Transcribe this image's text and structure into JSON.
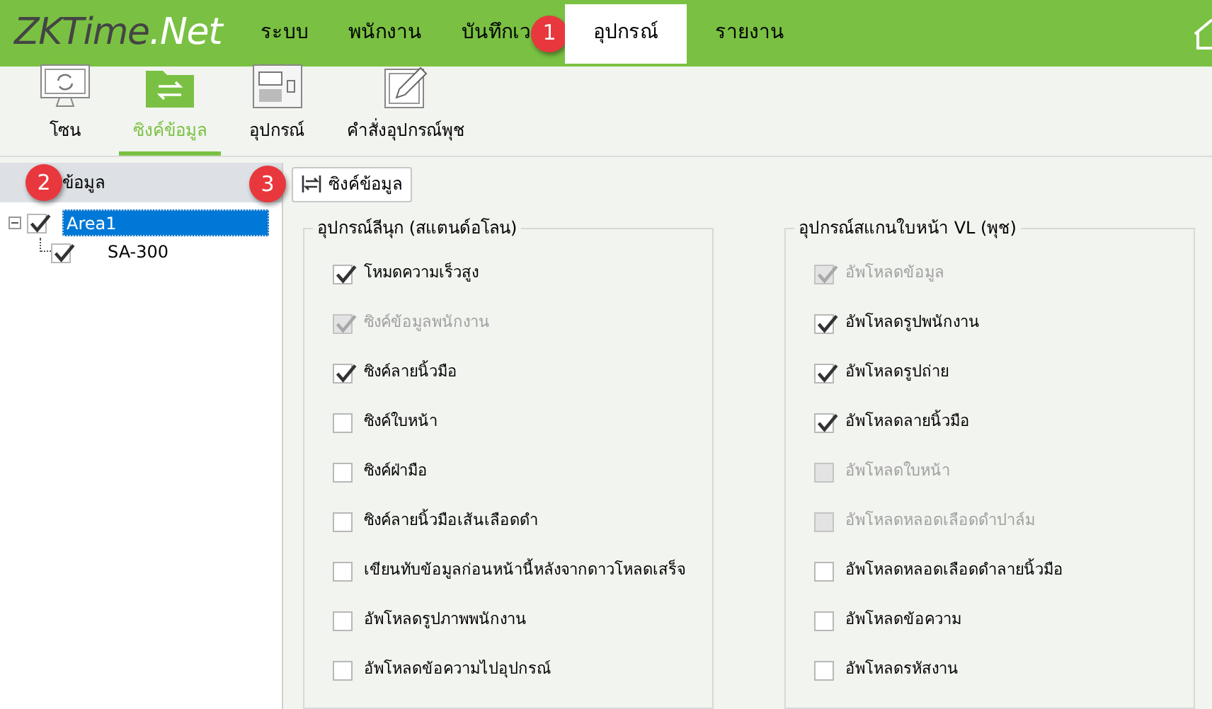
{
  "brand": {
    "main": "ZKTime",
    "suffix": ".Net"
  },
  "nav": [
    {
      "label": "ระบบ",
      "selected": false
    },
    {
      "label": "พนักงาน",
      "selected": false
    },
    {
      "label": "บันทึกเว",
      "selected": false,
      "badge": "1"
    },
    {
      "label": "อุปกรณ์",
      "selected": true
    },
    {
      "label": "รายงาน",
      "selected": false
    }
  ],
  "toolbar": [
    {
      "label": "โซน",
      "kind": "monitor",
      "selected": false
    },
    {
      "label": "ซิงค์ข้อมูล",
      "kind": "folder",
      "selected": true
    },
    {
      "label": "อุปกรณ์",
      "kind": "terminal",
      "selected": false
    },
    {
      "label": "คำสั่งอุปกรณ์พุช",
      "kind": "edit",
      "selected": false
    }
  ],
  "sidebar": {
    "title": "ข้อมูล",
    "badge": "2",
    "tree": [
      {
        "label": "Area1",
        "checked": true,
        "expanded": true,
        "selected": true,
        "children": [
          {
            "label": "SA-300",
            "checked": true,
            "selected": false
          }
        ]
      }
    ]
  },
  "sync_button": {
    "label": "ซิงค์ข้อมูล",
    "badge": "3"
  },
  "groups": [
    {
      "title": "อุปกรณ์ลีนุก (สแตนด์อโลน)",
      "options": [
        {
          "label": "โหมดความเร็วสูง",
          "checked": true,
          "disabled": false
        },
        {
          "label": "ซิงค์ข้อมูลพนักงาน",
          "checked": true,
          "disabled": true
        },
        {
          "label": "ซิงค์ลายนิ้วมือ",
          "checked": true,
          "disabled": false
        },
        {
          "label": "ซิงค์ใบหน้า",
          "checked": false,
          "disabled": false
        },
        {
          "label": "ซิงค์ฝ่ามือ",
          "checked": false,
          "disabled": false
        },
        {
          "label": "ซิงค์ลายนิ้วมือเส้นเลือดดำ",
          "checked": false,
          "disabled": false
        },
        {
          "label": "เขียนทับข้อมูลก่อนหน้านี้หลังจากดาวโหลดเสร็จ",
          "checked": false,
          "disabled": false
        },
        {
          "label": "อัพโหลดรูปภาพพนักงาน",
          "checked": false,
          "disabled": false
        },
        {
          "label": "อัพโหลดข้อความไปอุปกรณ์",
          "checked": false,
          "disabled": false
        }
      ]
    },
    {
      "title": "อุปกรณ์สแกนใบหน้า VL (พุช)",
      "options": [
        {
          "label": "อัพโหลดข้อมูล",
          "checked": true,
          "disabled": true
        },
        {
          "label": "อัพโหลดรูปพนักงาน",
          "checked": true,
          "disabled": false
        },
        {
          "label": "อัพโหลดรูปถ่าย",
          "checked": true,
          "disabled": false
        },
        {
          "label": "อัพโหลดลายนิ้วมือ",
          "checked": true,
          "disabled": false
        },
        {
          "label": "อัพโหลดใบหน้า",
          "checked": false,
          "disabled": true
        },
        {
          "label": "อัพโหลดหลอดเลือดดำปาล์ม",
          "checked": false,
          "disabled": true
        },
        {
          "label": "อัพโหลดหลอดเลือดดำลายนิ้วมือ",
          "checked": false,
          "disabled": false
        },
        {
          "label": "อัพโหลดข้อความ",
          "checked": false,
          "disabled": false
        },
        {
          "label": "อัพโหลดรหัสงาน",
          "checked": false,
          "disabled": false
        }
      ]
    }
  ]
}
